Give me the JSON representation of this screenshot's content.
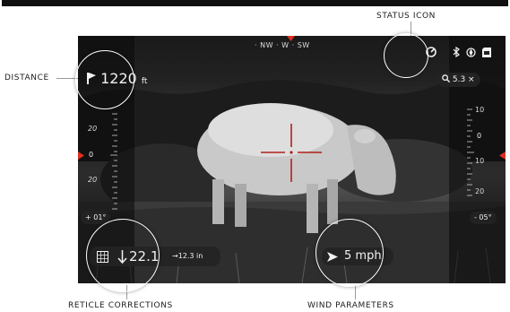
{
  "callouts": {
    "status_icon": "STATUS ICON",
    "distance": "DISTANCE",
    "reticle_corrections": "RETICLE CORRECTIONS",
    "wind_parameters": "WIND PARAMETERS"
  },
  "hud": {
    "compass": {
      "left": "NW",
      "center": "W",
      "right": "SW",
      "separator": "·"
    },
    "distance": {
      "icon": "flag-icon",
      "value": "1220",
      "unit": "ft"
    },
    "status_icons": [
      "status-dial-icon",
      "bluetooth-icon",
      "compass-sensor-icon",
      "sd-card-icon"
    ],
    "zoom": {
      "icon": "magnifier-icon",
      "value": "5.3 ×"
    },
    "left_scale": {
      "labels": [
        "20",
        "0",
        "20"
      ],
      "pitch": "+ 01°"
    },
    "right_scale": {
      "labels": [
        "10",
        "0",
        "10",
        "20"
      ],
      "roll": "- 05°"
    },
    "reticle_correction": {
      "icon": "reticle-grid-icon",
      "arrow_icon": "arrow-down-icon",
      "value": "22.1",
      "secondary": "→12.3 in"
    },
    "wind": {
      "icon": "wind-arrow-icon",
      "value": "5 mph"
    }
  },
  "colors": {
    "accent_red": "#e0301e",
    "hud_text": "#f2f2f2"
  }
}
